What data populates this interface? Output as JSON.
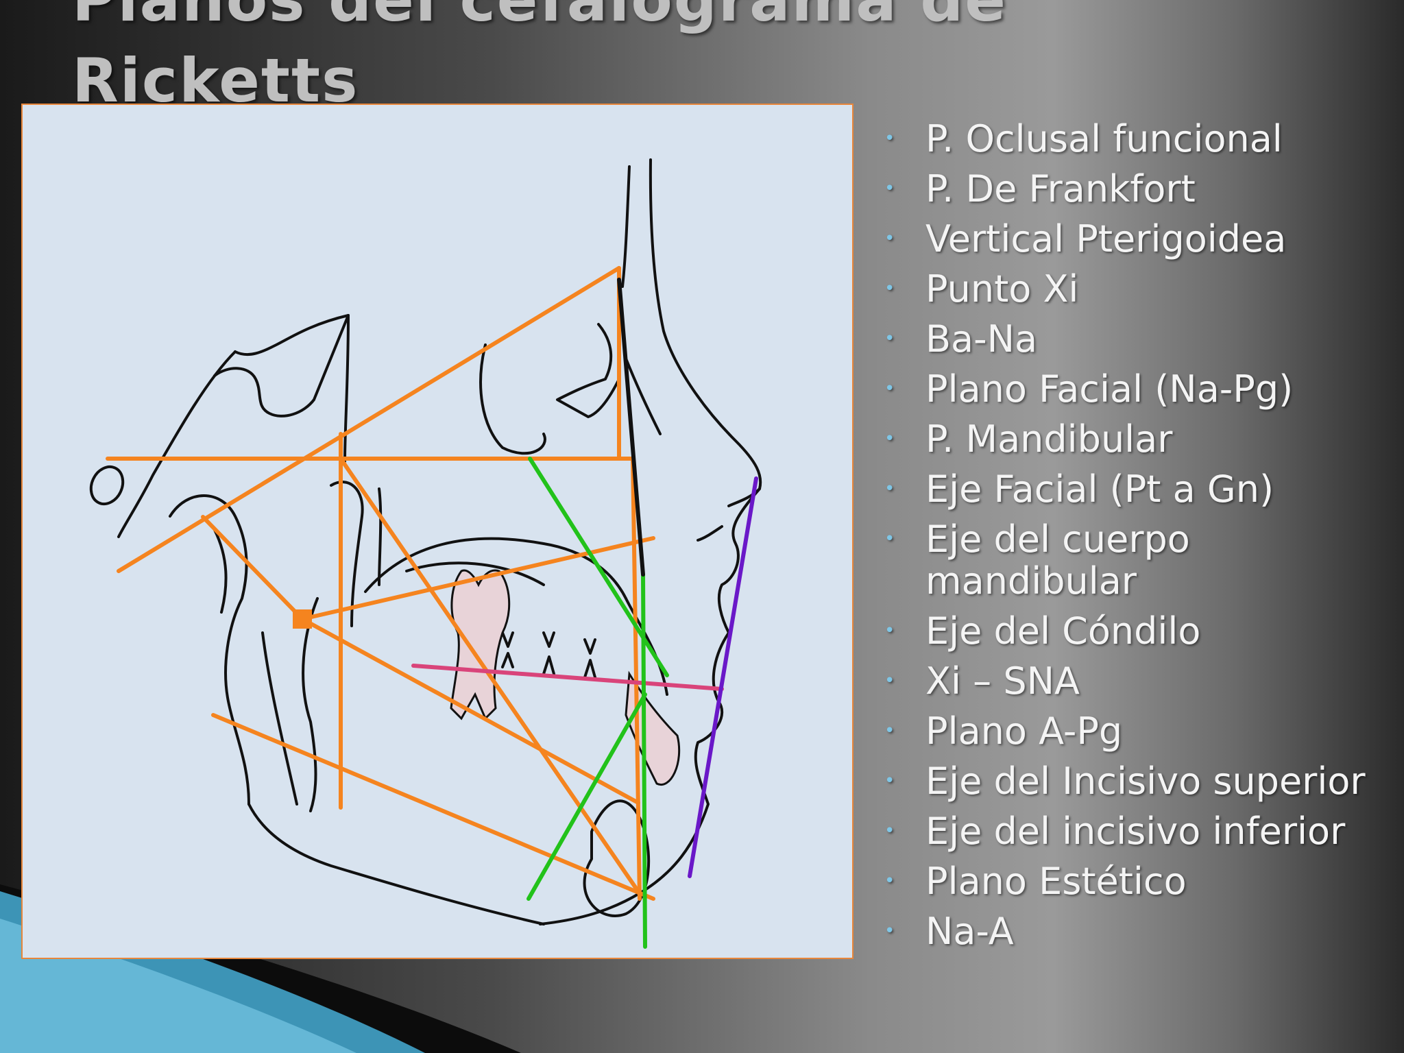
{
  "slide": {
    "title_line1": "Planos del cefalograma de",
    "title_line2": "Ricketts"
  },
  "legend": {
    "bullet": "•",
    "items": [
      "P. Oclusal funcional",
      "P. De Frankfort",
      "Vertical Pterigoidea",
      "Punto Xi",
      "Ba-Na",
      "Plano Facial (Na-Pg)",
      "P. Mandibular",
      "Eje Facial (Pt a Gn)",
      "Eje del cuerpo mandibular",
      "Eje del Cóndilo",
      "Xi – SNA",
      "Plano A-Pg",
      "Eje del Incisivo superior",
      "Eje del incisivo inferior",
      "Plano Estético",
      "Na-A"
    ]
  },
  "colors": {
    "orange_lines": "#f5841f",
    "green_lines": "#22c21a",
    "pink_line": "#d9447a",
    "purple_line": "#6a18c8",
    "black_line": "#111111",
    "figure_background": "#d8e3ef",
    "legend_bullet": "#7fc6e6"
  }
}
